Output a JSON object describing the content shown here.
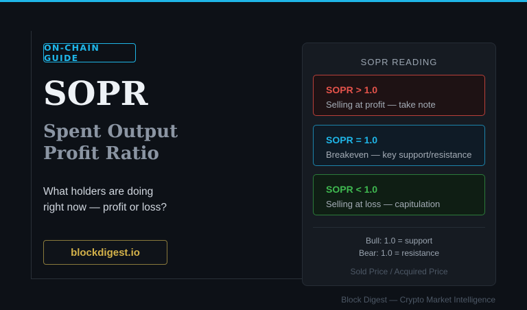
{
  "tag": "ON-CHAIN GUIDE",
  "title": "SOPR",
  "subtitle": [
    "Spent Output",
    "Profit Ratio"
  ],
  "description": [
    "What holders are doing",
    "right now — profit or loss?"
  ],
  "site_button": "blockdigest.io",
  "panel": {
    "title": "SOPR READING",
    "cards": [
      {
        "title": "SOPR > 1.0",
        "desc": "Selling at profit — take note",
        "accent": "#e5534b"
      },
      {
        "title": "SOPR = 1.0",
        "desc": "Breakeven — key support/resistance",
        "accent": "#1fb6e8"
      },
      {
        "title": "SOPR < 1.0",
        "desc": "Selling at loss — capitulation",
        "accent": "#3fb950"
      }
    ],
    "notes": [
      "Bull: 1.0 = support",
      "Bear: 1.0 = resistance"
    ],
    "formula": "Sold Price / Acquired Price"
  },
  "footer": "Block Digest — Crypto Market Intelligence",
  "colors": {
    "accent": "#1fb6e8",
    "gold": "#d4b24a",
    "background": "#0d1117"
  }
}
